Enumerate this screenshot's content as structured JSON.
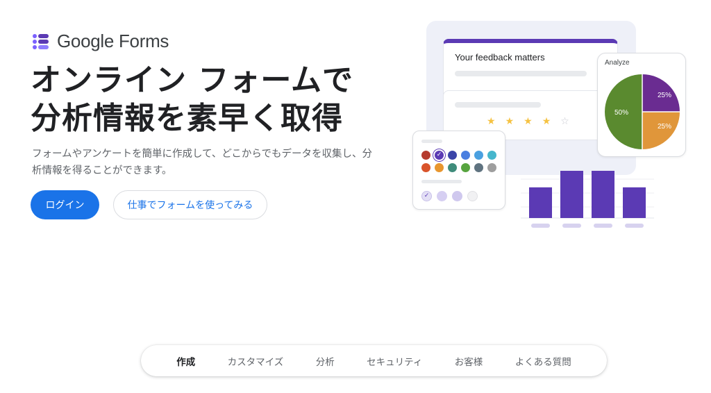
{
  "brand": {
    "name": "Google Forms",
    "accent": "#1a73e8",
    "purple": "#5b3ab4"
  },
  "hero": {
    "title_line1": "オンライン フォームで",
    "title_line2": "分析情報を素早く取得",
    "description": "フォームやアンケートを簡単に作成して、どこからでもデータを収集し、分析情報を得ることができます。",
    "login_label": "ログイン",
    "try_label": "仕事でフォームを使ってみる"
  },
  "illustration": {
    "form_title": "Your feedback matters",
    "rating": {
      "filled": 4,
      "total": 5
    },
    "analyze": {
      "label": "Analyze",
      "slices": [
        {
          "label": "25%",
          "value": 25,
          "color": "#6a2c91"
        },
        {
          "label": "25%",
          "value": 25,
          "color": "#e0963a"
        },
        {
          "label": "50%",
          "value": 50,
          "color": "#5a8a2f"
        }
      ]
    },
    "palette_row1": [
      "#b53b2e",
      "#5b3ab4",
      "#3b44a8",
      "#4a7fe0",
      "#4aa0e0",
      "#46b6cc"
    ],
    "palette_row2": [
      "#d9542b",
      "#e8962e",
      "#3f8c7b",
      "#57a43f",
      "#5f7380",
      "#9e9e9e"
    ],
    "palette_selected": 1,
    "bars": [
      65,
      100,
      100,
      65
    ]
  },
  "tabs": [
    {
      "label": "作成",
      "active": true
    },
    {
      "label": "カスタマイズ",
      "active": false
    },
    {
      "label": "分析",
      "active": false
    },
    {
      "label": "セキュリティ",
      "active": false
    },
    {
      "label": "お客様",
      "active": false
    },
    {
      "label": "よくある質問",
      "active": false
    }
  ]
}
